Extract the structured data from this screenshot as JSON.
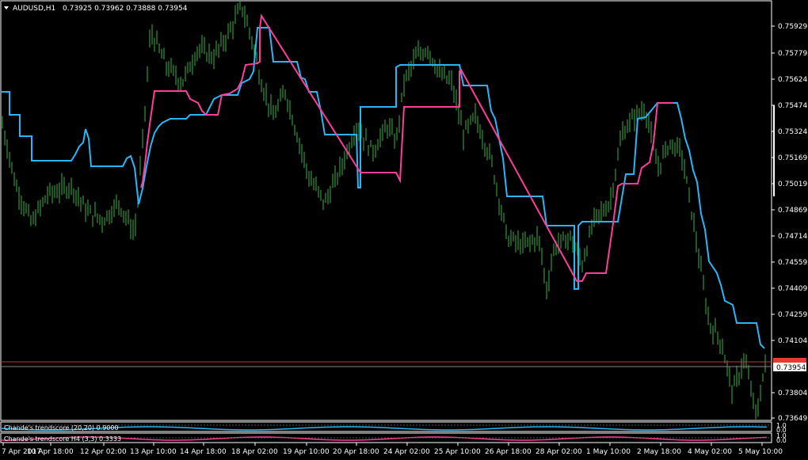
{
  "window": {
    "symbol_label": "AUDUSD,H1",
    "ohlc": "0.73925 0.73962 0.73888 0.73954"
  },
  "price_axis": {
    "labels": [
      "0.75929",
      "0.75779",
      "0.75624",
      "0.75474",
      "0.75324",
      "0.75169",
      "0.75019",
      "0.74869",
      "0.74714",
      "0.74559",
      "0.74409",
      "0.74259",
      "0.74104",
      "0.73804",
      "0.73649"
    ],
    "current_price": "0.73954",
    "alert_price": "0.73962"
  },
  "time_axis": {
    "labels": [
      "7 Apr 2017",
      "10 Apr 18:00",
      "12 Apr 02:00",
      "13 Apr 10:00",
      "14 Apr 18:00",
      "18 Apr 02:00",
      "19 Apr 10:00",
      "20 Apr 18:00",
      "24 Apr 02:00",
      "25 Apr 10:00",
      "26 Apr 18:00",
      "28 Apr 02:00",
      "1 May 10:00",
      "2 May 18:00",
      "4 May 02:00",
      "5 May 10:00"
    ]
  },
  "indicators": [
    {
      "label": "Chande's trendscore (20,20) 0.9000",
      "color": "#29b6f6"
    },
    {
      "label": "Chande's trendscore H4 (3,3) 0.3333",
      "color": "#ff3d9a"
    }
  ],
  "indicator_scale": [
    "1.0",
    "0.0",
    "1.0",
    "0.0"
  ],
  "colors": {
    "background": "#000000",
    "candles": "#3cb043",
    "upper_line": "#29b6f6",
    "lower_line": "#ff3d9a",
    "grid_line": "#ffffff",
    "price_line": "#c0392b",
    "alert_box": "#e53935"
  },
  "chart_data": {
    "type": "line",
    "series": [
      {
        "values": [
          0.755,
          0.753,
          0.7518,
          0.752,
          0.7518,
          0.7518,
          0.7521,
          0.7515,
          0.7509,
          0.7509,
          0.7509,
          0.7515,
          0.755,
          0.7575,
          0.759,
          0.759,
          0.7592,
          0.7596,
          0.7593,
          0.7593,
          0.7575,
          0.758,
          0.7565,
          0.7558,
          0.7545,
          0.753,
          0.753,
          0.7505,
          0.7555,
          0.7555,
          0.7556,
          0.7555,
          0.7553,
          0.7495,
          0.7495,
          0.7475,
          0.7475,
          0.7475,
          0.7475,
          0.7475,
          0.7475,
          0.7471,
          0.7478,
          0.7478,
          0.7478,
          0.755,
          0.7555,
          0.7555,
          0.7548,
          0.752,
          0.749,
          0.749,
          0.748,
          0.746,
          0.745,
          0.7445,
          0.742,
          0.7415,
          0.741,
          0.741
        ]
      }
    ]
  }
}
